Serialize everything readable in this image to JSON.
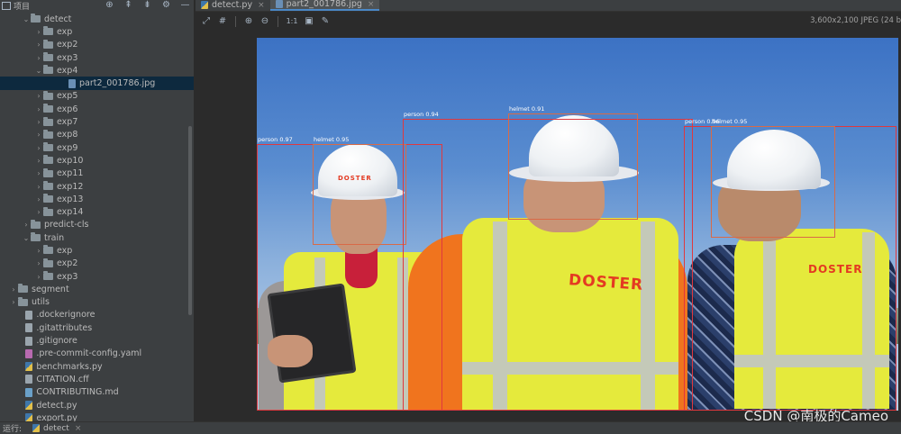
{
  "project_panel": {
    "title": "项目",
    "tools": [
      {
        "name": "locate-icon",
        "glyph": "⊕"
      },
      {
        "name": "collapse-all-icon",
        "glyph": "⇞"
      },
      {
        "name": "expand-all-icon",
        "glyph": "⇟"
      },
      {
        "name": "gear-icon",
        "glyph": "⚙"
      },
      {
        "name": "hide-icon",
        "glyph": "—"
      }
    ],
    "tree": [
      {
        "label": "detect",
        "indent": 1,
        "kind": "folder",
        "expanded": true
      },
      {
        "label": "exp",
        "indent": 2,
        "kind": "folder",
        "expanded": false
      },
      {
        "label": "exp2",
        "indent": 2,
        "kind": "folder",
        "expanded": false
      },
      {
        "label": "exp3",
        "indent": 2,
        "kind": "folder",
        "expanded": false
      },
      {
        "label": "exp4",
        "indent": 2,
        "kind": "folder",
        "expanded": true
      },
      {
        "label": "part2_001786.jpg",
        "indent": 4,
        "kind": "img",
        "selected": true
      },
      {
        "label": "exp5",
        "indent": 2,
        "kind": "folder",
        "expanded": false
      },
      {
        "label": "exp6",
        "indent": 2,
        "kind": "folder",
        "expanded": false
      },
      {
        "label": "exp7",
        "indent": 2,
        "kind": "folder",
        "expanded": false
      },
      {
        "label": "exp8",
        "indent": 2,
        "kind": "folder",
        "expanded": false
      },
      {
        "label": "exp9",
        "indent": 2,
        "kind": "folder",
        "expanded": false
      },
      {
        "label": "exp10",
        "indent": 2,
        "kind": "folder",
        "expanded": false
      },
      {
        "label": "exp11",
        "indent": 2,
        "kind": "folder",
        "expanded": false
      },
      {
        "label": "exp12",
        "indent": 2,
        "kind": "folder",
        "expanded": false
      },
      {
        "label": "exp13",
        "indent": 2,
        "kind": "folder",
        "expanded": false
      },
      {
        "label": "exp14",
        "indent": 2,
        "kind": "folder",
        "expanded": false
      },
      {
        "label": "predict-cls",
        "indent": 1,
        "kind": "folder",
        "expanded": false
      },
      {
        "label": "train",
        "indent": 1,
        "kind": "folder",
        "expanded": true
      },
      {
        "label": "exp",
        "indent": 2,
        "kind": "folder",
        "expanded": false
      },
      {
        "label": "exp2",
        "indent": 2,
        "kind": "folder",
        "expanded": false
      },
      {
        "label": "exp3",
        "indent": 2,
        "kind": "folder",
        "expanded": false
      },
      {
        "label": "segment",
        "indent": 0,
        "kind": "folder",
        "expanded": false
      },
      {
        "label": "utils",
        "indent": 0,
        "kind": "folder",
        "expanded": false
      },
      {
        "label": ".dockerignore",
        "indent": 0.6,
        "kind": "txt"
      },
      {
        "label": ".gitattributes",
        "indent": 0.6,
        "kind": "txt"
      },
      {
        "label": ".gitignore",
        "indent": 0.6,
        "kind": "txt"
      },
      {
        "label": ".pre-commit-config.yaml",
        "indent": 0.6,
        "kind": "yaml"
      },
      {
        "label": "benchmarks.py",
        "indent": 0.6,
        "kind": "py"
      },
      {
        "label": "CITATION.cff",
        "indent": 0.6,
        "kind": "txt"
      },
      {
        "label": "CONTRIBUTING.md",
        "indent": 0.6,
        "kind": "md"
      },
      {
        "label": "detect.py",
        "indent": 0.6,
        "kind": "py"
      },
      {
        "label": "export.py",
        "indent": 0.6,
        "kind": "py"
      }
    ]
  },
  "editor": {
    "tabs": [
      {
        "label": "detect.py",
        "kind": "py",
        "active": false
      },
      {
        "label": "part2_001786.jpg",
        "kind": "img",
        "active": true
      }
    ],
    "image_toolbar": [
      {
        "name": "fit-to-window-icon",
        "glyph": "⤢"
      },
      {
        "name": "grid-icon",
        "glyph": "#"
      },
      {
        "name": "zoom-in-icon",
        "glyph": "⊕"
      },
      {
        "name": "zoom-out-icon",
        "glyph": "⊖"
      },
      {
        "name": "actual-size-icon",
        "glyph": "1:1"
      },
      {
        "name": "background-icon",
        "glyph": "▣"
      },
      {
        "name": "color-picker-icon",
        "glyph": "✎"
      }
    ],
    "image_info": "3,600x2,100 JPEG (24 b",
    "detections": [
      {
        "label": "person 0.97"
      },
      {
        "label": "helmet 0.95"
      },
      {
        "label": "person 0.94"
      },
      {
        "label": "helmet 0.91"
      },
      {
        "label": "person 0.96"
      },
      {
        "label": "helmet 0.95"
      }
    ],
    "vest_brand": "DOSTER",
    "watermark": "CSDN @南极的Cameo"
  },
  "run_bar": {
    "label": "运行:",
    "tab": "detect"
  },
  "colors": {
    "person_box": "#e0383e",
    "helmet_box": "#d96a47",
    "selection": "#0d293e",
    "active_tab_underline": "#4a88c7"
  }
}
